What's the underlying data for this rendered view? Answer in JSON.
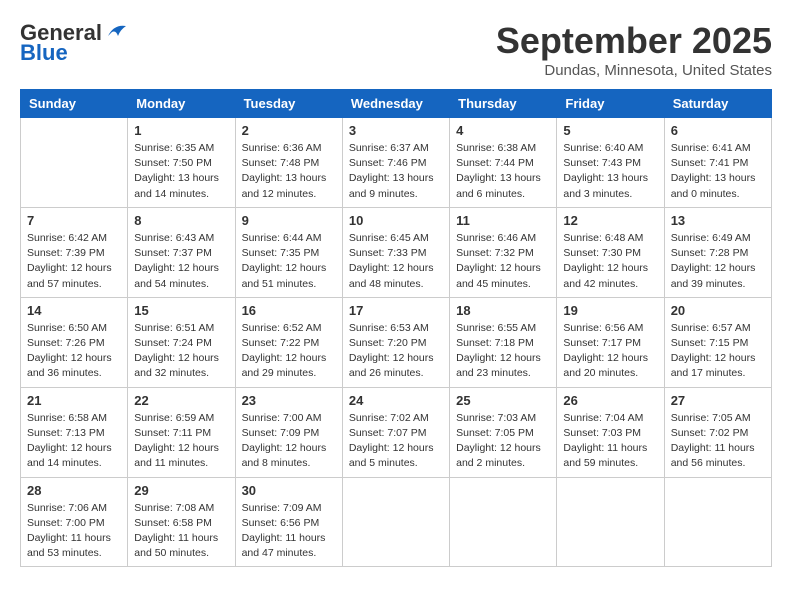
{
  "header": {
    "logo_general": "General",
    "logo_blue": "Blue",
    "month_title": "September 2025",
    "subtitle": "Dundas, Minnesota, United States"
  },
  "weekdays": [
    "Sunday",
    "Monday",
    "Tuesday",
    "Wednesday",
    "Thursday",
    "Friday",
    "Saturday"
  ],
  "weeks": [
    [
      {
        "day": "",
        "info": ""
      },
      {
        "day": "1",
        "info": "Sunrise: 6:35 AM\nSunset: 7:50 PM\nDaylight: 13 hours\nand 14 minutes."
      },
      {
        "day": "2",
        "info": "Sunrise: 6:36 AM\nSunset: 7:48 PM\nDaylight: 13 hours\nand 12 minutes."
      },
      {
        "day": "3",
        "info": "Sunrise: 6:37 AM\nSunset: 7:46 PM\nDaylight: 13 hours\nand 9 minutes."
      },
      {
        "day": "4",
        "info": "Sunrise: 6:38 AM\nSunset: 7:44 PM\nDaylight: 13 hours\nand 6 minutes."
      },
      {
        "day": "5",
        "info": "Sunrise: 6:40 AM\nSunset: 7:43 PM\nDaylight: 13 hours\nand 3 minutes."
      },
      {
        "day": "6",
        "info": "Sunrise: 6:41 AM\nSunset: 7:41 PM\nDaylight: 13 hours\nand 0 minutes."
      }
    ],
    [
      {
        "day": "7",
        "info": "Sunrise: 6:42 AM\nSunset: 7:39 PM\nDaylight: 12 hours\nand 57 minutes."
      },
      {
        "day": "8",
        "info": "Sunrise: 6:43 AM\nSunset: 7:37 PM\nDaylight: 12 hours\nand 54 minutes."
      },
      {
        "day": "9",
        "info": "Sunrise: 6:44 AM\nSunset: 7:35 PM\nDaylight: 12 hours\nand 51 minutes."
      },
      {
        "day": "10",
        "info": "Sunrise: 6:45 AM\nSunset: 7:33 PM\nDaylight: 12 hours\nand 48 minutes."
      },
      {
        "day": "11",
        "info": "Sunrise: 6:46 AM\nSunset: 7:32 PM\nDaylight: 12 hours\nand 45 minutes."
      },
      {
        "day": "12",
        "info": "Sunrise: 6:48 AM\nSunset: 7:30 PM\nDaylight: 12 hours\nand 42 minutes."
      },
      {
        "day": "13",
        "info": "Sunrise: 6:49 AM\nSunset: 7:28 PM\nDaylight: 12 hours\nand 39 minutes."
      }
    ],
    [
      {
        "day": "14",
        "info": "Sunrise: 6:50 AM\nSunset: 7:26 PM\nDaylight: 12 hours\nand 36 minutes."
      },
      {
        "day": "15",
        "info": "Sunrise: 6:51 AM\nSunset: 7:24 PM\nDaylight: 12 hours\nand 32 minutes."
      },
      {
        "day": "16",
        "info": "Sunrise: 6:52 AM\nSunset: 7:22 PM\nDaylight: 12 hours\nand 29 minutes."
      },
      {
        "day": "17",
        "info": "Sunrise: 6:53 AM\nSunset: 7:20 PM\nDaylight: 12 hours\nand 26 minutes."
      },
      {
        "day": "18",
        "info": "Sunrise: 6:55 AM\nSunset: 7:18 PM\nDaylight: 12 hours\nand 23 minutes."
      },
      {
        "day": "19",
        "info": "Sunrise: 6:56 AM\nSunset: 7:17 PM\nDaylight: 12 hours\nand 20 minutes."
      },
      {
        "day": "20",
        "info": "Sunrise: 6:57 AM\nSunset: 7:15 PM\nDaylight: 12 hours\nand 17 minutes."
      }
    ],
    [
      {
        "day": "21",
        "info": "Sunrise: 6:58 AM\nSunset: 7:13 PM\nDaylight: 12 hours\nand 14 minutes."
      },
      {
        "day": "22",
        "info": "Sunrise: 6:59 AM\nSunset: 7:11 PM\nDaylight: 12 hours\nand 11 minutes."
      },
      {
        "day": "23",
        "info": "Sunrise: 7:00 AM\nSunset: 7:09 PM\nDaylight: 12 hours\nand 8 minutes."
      },
      {
        "day": "24",
        "info": "Sunrise: 7:02 AM\nSunset: 7:07 PM\nDaylight: 12 hours\nand 5 minutes."
      },
      {
        "day": "25",
        "info": "Sunrise: 7:03 AM\nSunset: 7:05 PM\nDaylight: 12 hours\nand 2 minutes."
      },
      {
        "day": "26",
        "info": "Sunrise: 7:04 AM\nSunset: 7:03 PM\nDaylight: 11 hours\nand 59 minutes."
      },
      {
        "day": "27",
        "info": "Sunrise: 7:05 AM\nSunset: 7:02 PM\nDaylight: 11 hours\nand 56 minutes."
      }
    ],
    [
      {
        "day": "28",
        "info": "Sunrise: 7:06 AM\nSunset: 7:00 PM\nDaylight: 11 hours\nand 53 minutes."
      },
      {
        "day": "29",
        "info": "Sunrise: 7:08 AM\nSunset: 6:58 PM\nDaylight: 11 hours\nand 50 minutes."
      },
      {
        "day": "30",
        "info": "Sunrise: 7:09 AM\nSunset: 6:56 PM\nDaylight: 11 hours\nand 47 minutes."
      },
      {
        "day": "",
        "info": ""
      },
      {
        "day": "",
        "info": ""
      },
      {
        "day": "",
        "info": ""
      },
      {
        "day": "",
        "info": ""
      }
    ]
  ]
}
